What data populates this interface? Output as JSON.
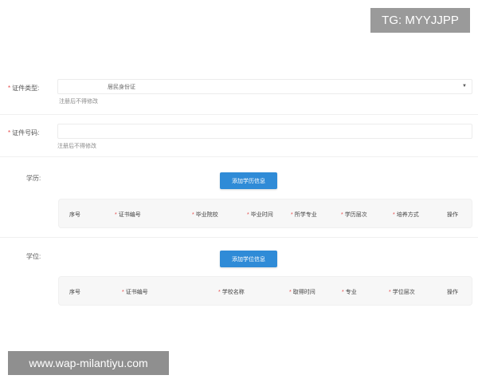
{
  "watermarks": {
    "tg": "TG: MYYJJPP",
    "url": "www.wap-milantiyu.com"
  },
  "required_mark": "*",
  "form": {
    "id_type": {
      "label": "证件类型:",
      "value": "居民身份证",
      "hint": "注册后不得修改"
    },
    "id_number": {
      "label": "证件号码:",
      "value": "",
      "hint": "注册后不得修改"
    }
  },
  "education": {
    "label": "学历:",
    "add_button": "添加学历信息",
    "columns": [
      {
        "text": "序号",
        "required": false
      },
      {
        "text": "证书编号",
        "required": true
      },
      {
        "text": "毕业院校",
        "required": true
      },
      {
        "text": "毕业时间",
        "required": true
      },
      {
        "text": "所学专业",
        "required": true
      },
      {
        "text": "学历层次",
        "required": true
      },
      {
        "text": "培养方式",
        "required": true
      },
      {
        "text": "操作",
        "required": false
      }
    ]
  },
  "degree": {
    "label": "学位:",
    "add_button": "添加学位信息",
    "columns": [
      {
        "text": "序号",
        "required": false
      },
      {
        "text": "证书编号",
        "required": true
      },
      {
        "text": "学校名称",
        "required": true
      },
      {
        "text": "取得时间",
        "required": true
      },
      {
        "text": "专业",
        "required": true
      },
      {
        "text": "学位层次",
        "required": true
      },
      {
        "text": "操作",
        "required": false
      }
    ]
  }
}
